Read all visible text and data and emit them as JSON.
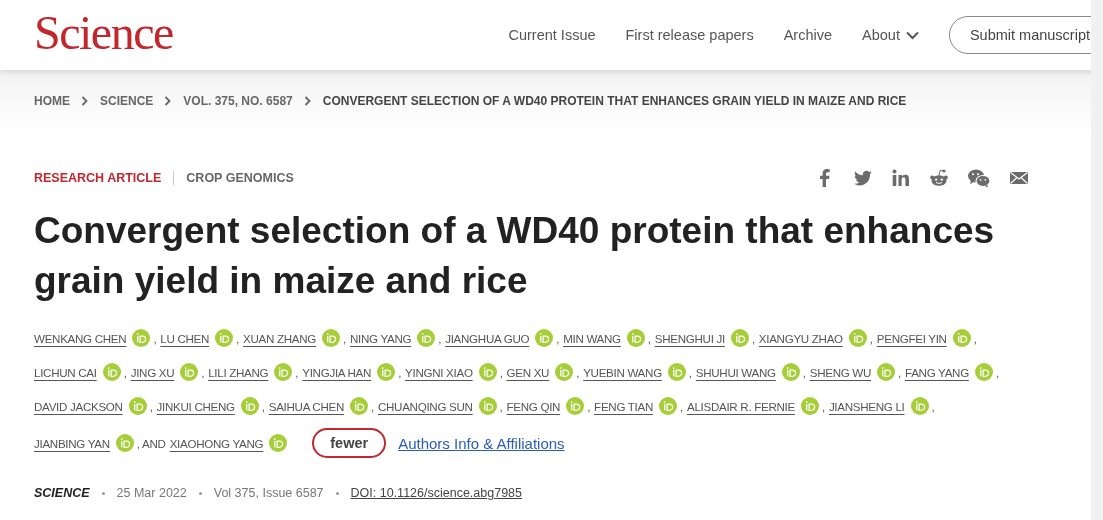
{
  "header": {
    "logo": "Science",
    "nav": [
      {
        "label": "Current Issue",
        "dropdown": false
      },
      {
        "label": "First release papers",
        "dropdown": false
      },
      {
        "label": "Archive",
        "dropdown": false
      },
      {
        "label": "About",
        "dropdown": true
      }
    ],
    "submit": "Submit manuscript"
  },
  "breadcrumb": [
    "HOME",
    "SCIENCE",
    "VOL. 375, NO. 6587",
    "CONVERGENT SELECTION OF A WD40 PROTEIN THAT ENHANCES GRAIN YIELD IN MAIZE AND RICE"
  ],
  "article": {
    "type": "RESEARCH ARTICLE",
    "section": "CROP GENOMICS",
    "share": [
      {
        "kind": "facebook"
      },
      {
        "kind": "twitter"
      },
      {
        "kind": "linkedin"
      },
      {
        "kind": "reddit"
      },
      {
        "kind": "wechat"
      },
      {
        "kind": "email"
      }
    ],
    "title": "Convergent selection of a WD40 protein that enhances grain yield in maize and rice",
    "authors": [
      {
        "name": "WENKANG CHEN",
        "orcid": true,
        "after": ","
      },
      {
        "name": "LU CHEN",
        "orcid": true,
        "after": ","
      },
      {
        "name": "XUAN ZHANG",
        "orcid": true,
        "after": ","
      },
      {
        "name": "NING YANG",
        "orcid": true,
        "after": ","
      },
      {
        "name": "JIANGHUA GUO",
        "orcid": true,
        "after": ","
      },
      {
        "name": "MIN WANG",
        "orcid": true,
        "after": ","
      },
      {
        "name": "SHENGHUI JI",
        "orcid": true,
        "after": ","
      },
      {
        "name": "XIANGYU ZHAO",
        "orcid": true,
        "after": ","
      },
      {
        "name": "PENGFEI YIN",
        "orcid": true,
        "after": ","
      },
      {
        "name": "LICHUN CAI",
        "orcid": true,
        "after": ","
      },
      {
        "name": "JING XU",
        "orcid": true,
        "after": ","
      },
      {
        "name": "LILI ZHANG",
        "orcid": true,
        "after": ","
      },
      {
        "name": "YINGJIA HAN",
        "orcid": true,
        "after": ","
      },
      {
        "name": "YINGNI XIAO",
        "orcid": true,
        "after": ","
      },
      {
        "name": "GEN XU",
        "orcid": true,
        "after": ","
      },
      {
        "name": "YUEBIN WANG",
        "orcid": true,
        "after": ","
      },
      {
        "name": "SHUHUI WANG",
        "orcid": true,
        "after": ","
      },
      {
        "name": "SHENG WU",
        "orcid": true,
        "after": ","
      },
      {
        "name": "FANG YANG",
        "orcid": true,
        "after": ","
      },
      {
        "name": "DAVID JACKSON",
        "orcid": true,
        "after": ","
      },
      {
        "name": "JINKUI CHENG",
        "orcid": true,
        "after": ","
      },
      {
        "name": "SAIHUA CHEN",
        "orcid": true,
        "after": ","
      },
      {
        "name": "CHUANQING SUN",
        "orcid": true,
        "after": ","
      },
      {
        "name": "FENG QIN",
        "orcid": true,
        "after": ","
      },
      {
        "name": "FENG TIAN",
        "orcid": true,
        "after": ","
      },
      {
        "name": "ALISDAIR R. FERNIE",
        "orcid": true,
        "after": ","
      },
      {
        "name": "JIANSHENG LI",
        "orcid": true,
        "after": ","
      },
      {
        "name": "JIANBING YAN",
        "orcid": true,
        "after": ", AND"
      },
      {
        "name": "XIAOHONG YANG",
        "orcid": true
      }
    ],
    "fewer": "fewer",
    "affiliations": "Authors Info & Affiliations",
    "meta": {
      "journal": "SCIENCE",
      "date": "25 Mar 2022",
      "volume": "Vol 375, Issue 6587",
      "doi": "DOI: 10.1126/science.abg7985"
    }
  }
}
